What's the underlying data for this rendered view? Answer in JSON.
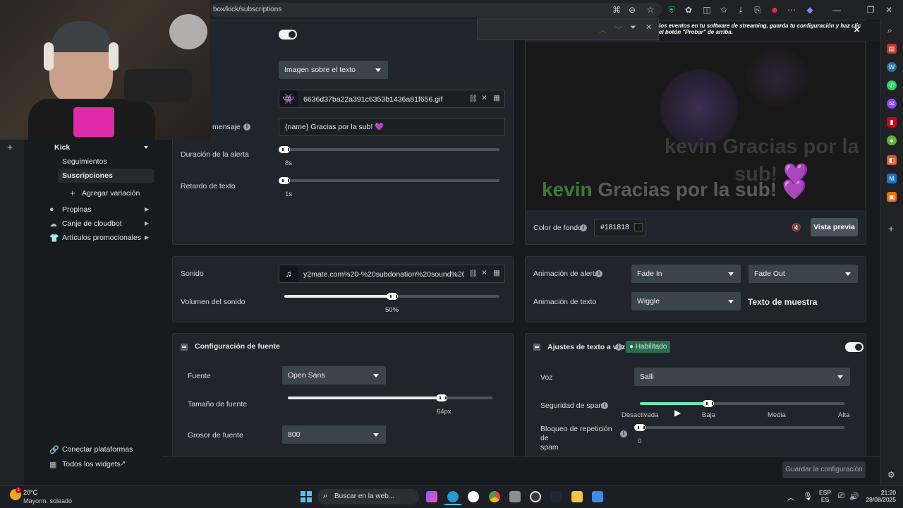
{
  "browser": {
    "url": "box/kick/subscriptions",
    "find_bar": {
      "value": ""
    }
  },
  "notification": {
    "text_line1": "los eventos en tu software de streaming, guarda tu configuración y haz clic",
    "text_line2": "el botón \"Probar\" de arriba."
  },
  "sidebar": {
    "kick": "Kick",
    "seguimientos": "Seguimientos",
    "suscripciones": "Suscripciones",
    "agregar_variacion": "Agregar variación",
    "propinas": "Propinas",
    "canje": "Canje de cloudbot",
    "articulos": "Artículos promocionales",
    "conectar": "Conectar plataformas",
    "widgets": "Todos los widgets"
  },
  "alert_card": {
    "layout_value": "Imagen sobre el texto",
    "image_file": "6636d37ba22a391c6353b1436a81f656.gif",
    "mensaje_label": "mensaje",
    "mensaje_value": "{name} Gracias por la sub! 💜",
    "duracion_label": "Duración de la alerta",
    "duracion_value": "8s",
    "duracion_fraction": 0.0,
    "retardo_label": "Retardo de texto",
    "retardo_value": "1s",
    "retardo_fraction": 0.0
  },
  "preview": {
    "ghost_text": "kevin Gracias por la sub!",
    "name": "kevin",
    "message": "Gracias por la sub!",
    "heart": "💜",
    "bg_label": "Color de fondo",
    "bg_value": "#181818",
    "preview_button": "Vista previa"
  },
  "sound_card": {
    "sonido_label": "Sonido",
    "sonido_file": "y2mate.com%20-%20subdonation%20sound%201.m...",
    "volumen_label": "Volumen del sonido",
    "volumen_value": "50%",
    "volumen_fraction": 0.5
  },
  "animation_card": {
    "alerta_label": "Animación de alerta",
    "alerta_in": "Fade In",
    "alerta_out": "Fade Out",
    "texto_label": "Animación de texto",
    "texto_value": "Wiggle",
    "sample": "Texto de muestra"
  },
  "font_card": {
    "title": "Configuración de fuente",
    "fuente_label": "Fuente",
    "fuente_value": "Open Sans",
    "tamano_label": "Tamaño de fuente",
    "tamano_value": "64px",
    "tamano_fraction": 0.75,
    "grosor_label": "Grosor de fuente",
    "grosor_value": "800"
  },
  "tts_card": {
    "title": "Ajustes de texto a voz",
    "badge": "Habilitado",
    "voz_label": "Voz",
    "voz_value": "Salli",
    "spam_label": "Seguridad de spam",
    "spam_levels": [
      "Desactivada",
      "Baja",
      "Media",
      "Alta"
    ],
    "spam_fraction": 0.333,
    "bloqueo_label": "Bloqueo de repetición de spam",
    "bloqueo_line1": "Bloqueo de repetición de",
    "bloqueo_line2": "spam",
    "bloqueo_value": "0"
  },
  "footer": {
    "save": "Guardar la configuración"
  },
  "taskbar": {
    "weather_temp": "20°C",
    "weather_desc": "Mayorm. soleado",
    "search_placeholder": "Buscar en la web...",
    "lang": "ESP",
    "lang_sub": "ES",
    "time": "21:20",
    "date": "28/08/2025"
  },
  "colors": {
    "accent_green": "#6ee7b7",
    "preview_green": "#3b7a3e",
    "preview_purple": "#7b3fa8"
  }
}
